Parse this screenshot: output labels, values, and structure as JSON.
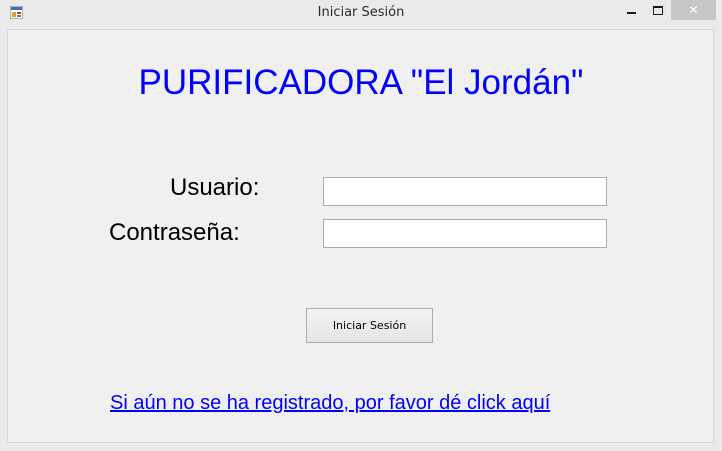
{
  "window": {
    "title": "Iniciar Sesión",
    "close_glyph": "✕"
  },
  "form": {
    "heading": "PURIFICADORA \"El Jordán\"",
    "username_label": "Usuario:",
    "username_value": "",
    "password_label": "Contraseña:",
    "password_value": "",
    "login_button": "Iniciar Sesión",
    "register_link": "Si aún no se ha registrado, por favor dé click aquí"
  },
  "colors": {
    "heading": "#0000ff",
    "link": "#0000ff",
    "form_background": "#f0f0f0"
  },
  "icons": {
    "app": "windows-form-icon",
    "minimize": "minimize-icon",
    "maximize": "maximize-icon",
    "close": "close-icon"
  }
}
